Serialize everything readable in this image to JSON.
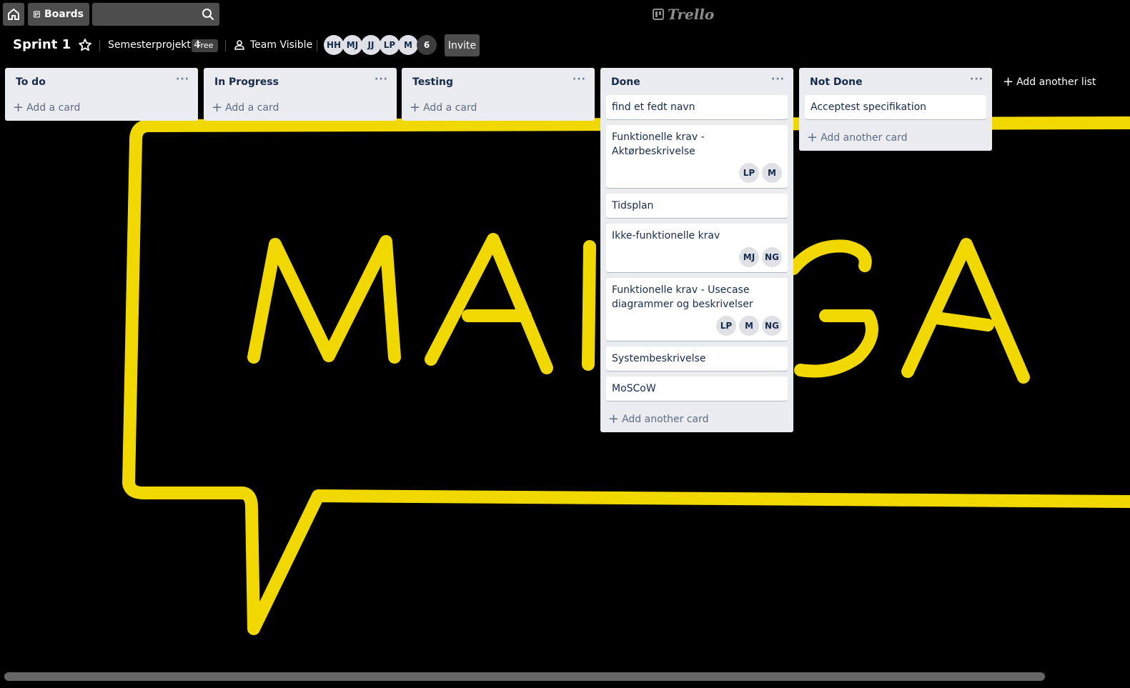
{
  "topbar": {
    "boards_label": "Boards",
    "search_value": "",
    "logo_text": "Trello"
  },
  "board": {
    "title": "Sprint 1",
    "team": "Semesterprojekt 4",
    "plan_badge": "Free",
    "visibility": "Team Visible",
    "members": [
      "HH",
      "MJ",
      "JJ",
      "LP",
      "M"
    ],
    "member_count": "6",
    "invite_label": "Invite"
  },
  "lists": [
    {
      "title": "To do",
      "menu": "···",
      "add_label": "Add a card"
    },
    {
      "title": "In Progress",
      "menu": "···",
      "add_label": "Add a card"
    },
    {
      "title": "Testing",
      "menu": "···",
      "add_label": "Add a card"
    },
    {
      "title": "Done",
      "menu": "···",
      "add_label": "Add another card",
      "cards": [
        {
          "title": "find et fedt navn",
          "members": []
        },
        {
          "title": "Funktionelle krav - Aktørbeskrivelse",
          "members": [
            "LP",
            "M"
          ]
        },
        {
          "title": "Tidsplan",
          "members": []
        },
        {
          "title": "Ikke-funktionelle krav",
          "members": [
            "MJ",
            "NG"
          ]
        },
        {
          "title": "Funktionelle krav - Usecase diagrammer og beskrivelser",
          "members": [
            "LP",
            "M",
            "NG"
          ]
        },
        {
          "title": "Systembeskrivelse",
          "members": []
        },
        {
          "title": "MoSCoW",
          "members": []
        }
      ]
    },
    {
      "title": "Not Done",
      "menu": "···",
      "add_label": "Add another card",
      "cards": [
        {
          "title": "Acceptest specifikation",
          "members": []
        }
      ]
    }
  ],
  "add_list_label": "Add another list",
  "colors": {
    "neon": "#f4dd00",
    "list_bg": "#ebecf0",
    "page_bg": "#000000"
  }
}
